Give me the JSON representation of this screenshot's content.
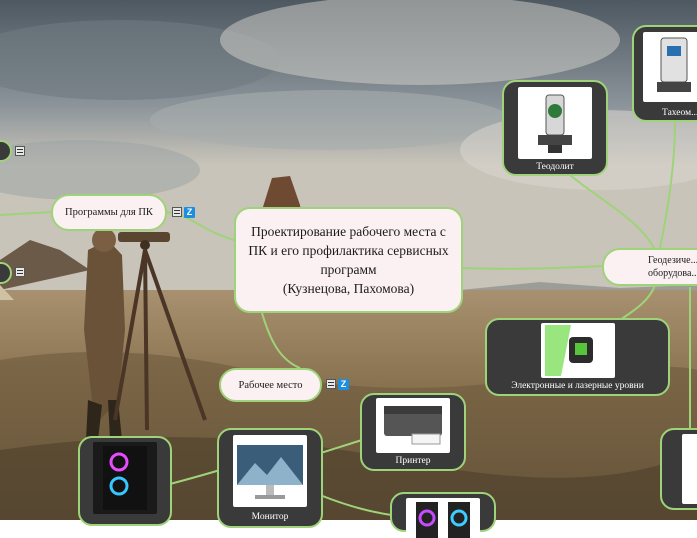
{
  "central": {
    "line1": "Проектирование рабочего места с ПК и его профилактика сервисных программ",
    "line2": "(Кузнецова, Пахомова)"
  },
  "nodes": {
    "programs": "Программы для ПК",
    "workplace": "Рабочее место",
    "geodetic": "Геодезическое оборудование"
  },
  "geodetic_cut": "Геодезиче... оборудова...",
  "image_nodes": {
    "theodolite": "Теодолит",
    "tacheometer": "Тахеометр",
    "levels": "Электронные и лазерные уровни",
    "printer": "Принтер",
    "monitor": "Монитор",
    "tacheometer_cut": "Тахеом..."
  },
  "icons": {
    "note": "note-icon",
    "zoom": "z-link-icon",
    "zoom_glyph": "Z"
  },
  "colors": {
    "connector": "#9fd37a",
    "node_fill": "#fbf1f3",
    "dark_fill": "#3a3a3a"
  }
}
